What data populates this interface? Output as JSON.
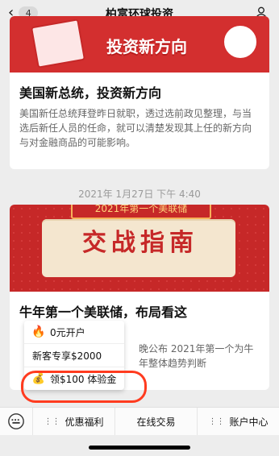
{
  "header": {
    "back_badge": "4",
    "title": "柏富环球投资"
  },
  "card1": {
    "banner_text": "投资新方向",
    "headline": "美国新总统，投资新方向",
    "body": "美国新任总统拜登昨日就职，透过选前政见整理，与当选后新任人员的任命，就可以清楚发现其上任的新方向与对金融商品的可能影响。"
  },
  "date_label": "2021年 1月27日 下午 4:40",
  "card2": {
    "ribbon": "2021年第一个美联储",
    "banner_title": "交战指南",
    "headline": "牛年第一个美联储，布局看这",
    "body_right": "晚公布 2021年第一个为牛年整体趋势判断"
  },
  "popup": {
    "items": [
      {
        "label": "0元开户"
      },
      {
        "label": "新客专享$2000"
      },
      {
        "label": "领$100 体验金"
      }
    ]
  },
  "bottom_bar": {
    "tabs": [
      {
        "label": "优惠福利"
      },
      {
        "label": "在线交易"
      },
      {
        "label": "账户中心"
      }
    ]
  },
  "colors": {
    "brand_red": "#d32f2f",
    "highlight_red": "#ff3b1f"
  }
}
